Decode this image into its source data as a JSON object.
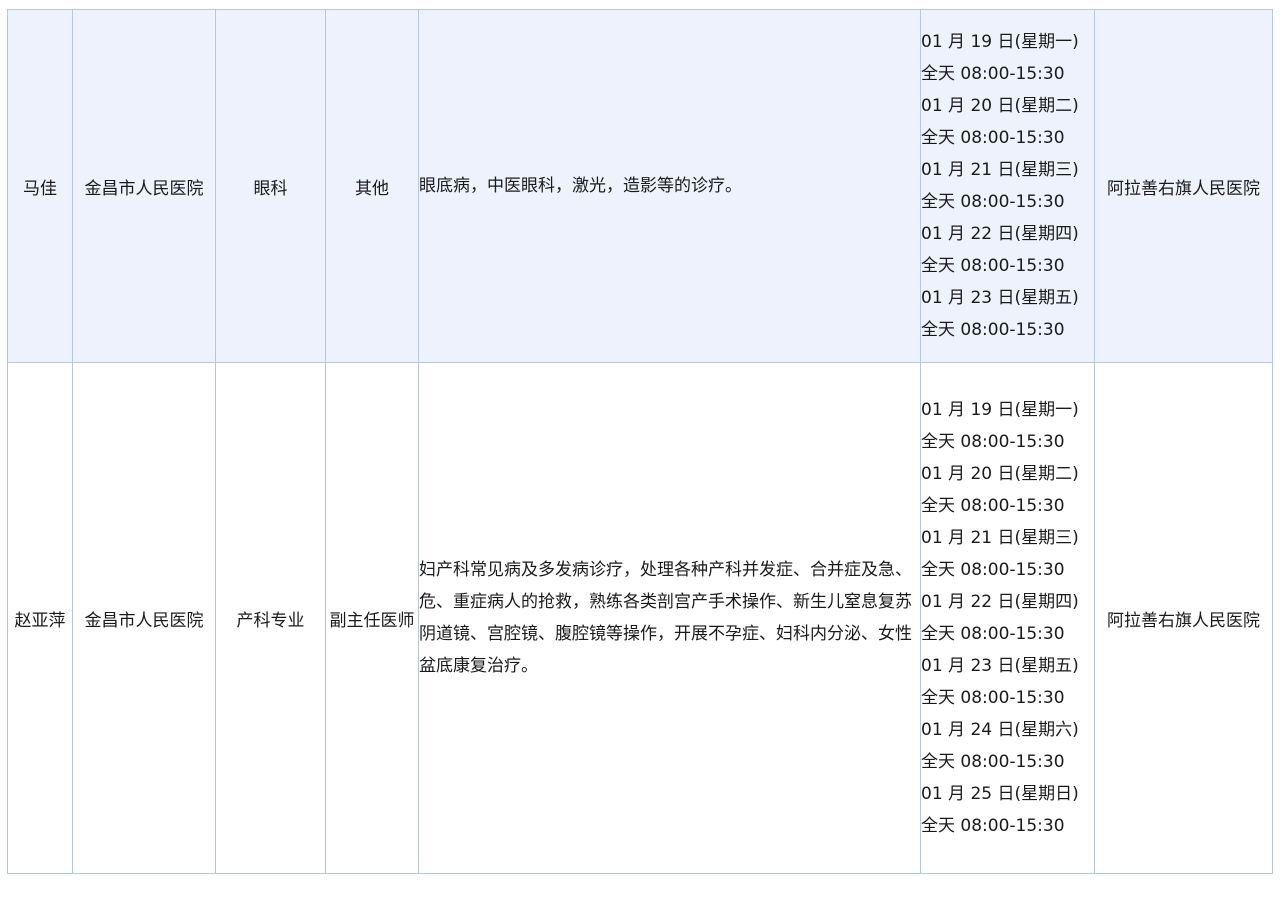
{
  "rows": [
    {
      "name": "马佳",
      "hospital": "金昌市人民医院",
      "department": "眼科",
      "title": "其他",
      "specialty": "眼底病，中医眼科，激光，造影等的诊疗。",
      "schedule": [
        "01 月 19 日(星期一)",
        "全天 08:00-15:30",
        "01 月 20 日(星期二)",
        "全天 08:00-15:30",
        "01 月 21 日(星期三)",
        "全天 08:00-15:30",
        "01 月 22 日(星期四)",
        "全天 08:00-15:30",
        "01 月 23 日(星期五)",
        "全天 08:00-15:30"
      ],
      "location": "阿拉善右旗人民医院"
    },
    {
      "name": "赵亚萍",
      "hospital": "金昌市人民医院",
      "department": "产科专业",
      "title": "副主任医师",
      "specialty": "妇产科常见病及多发病诊疗，处理各种产科并发症、合并症及急、危、重症病人的抢救，熟练各类剖宫产手术操作、新生儿窒息复苏阴道镜、宫腔镜、腹腔镜等操作，开展不孕症、妇科内分泌、女性盆底康复治疗。",
      "schedule": [
        "01 月 19 日(星期一)",
        "全天 08:00-15:30",
        "01 月 20 日(星期二)",
        "全天 08:00-15:30",
        "01 月 21 日(星期三)",
        "全天 08:00-15:30",
        "01 月 22 日(星期四)",
        "全天 08:00-15:30",
        "01 月 23 日(星期五)",
        "全天 08:00-15:30",
        "01 月 24 日(星期六)",
        "全天 08:00-15:30",
        "01 月 25 日(星期日)",
        "全天 08:00-15:30"
      ],
      "location": "阿拉善右旗人民医院"
    }
  ]
}
